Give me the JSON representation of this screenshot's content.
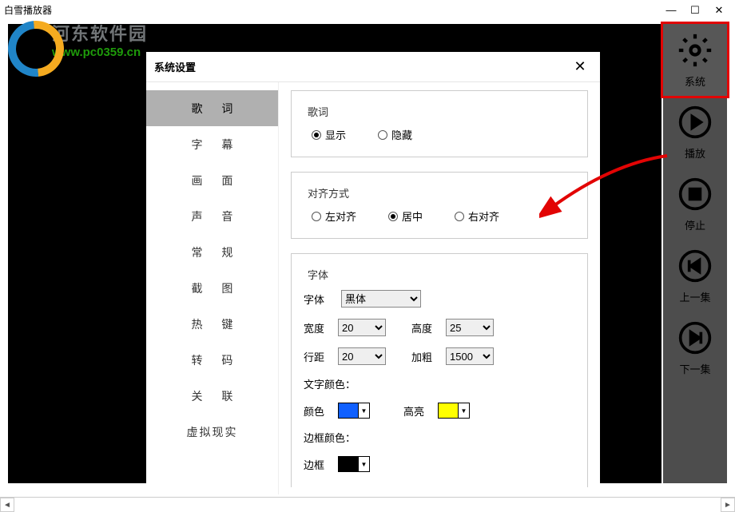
{
  "app_title": "白雪播放器",
  "watermark": {
    "text_top": "河东软件园",
    "text_bottom": "www.pc0359.cn"
  },
  "sidebar": [
    {
      "name": "system",
      "label": "系统",
      "icon": "gear",
      "highlighted": true
    },
    {
      "name": "play",
      "label": "播放",
      "icon": "play"
    },
    {
      "name": "stop",
      "label": "停止",
      "icon": "stop"
    },
    {
      "name": "prev",
      "label": "上一集",
      "icon": "prev"
    },
    {
      "name": "next",
      "label": "下一集",
      "icon": "next"
    }
  ],
  "modal": {
    "title": "系统设置",
    "tabs": [
      "歌  词",
      "字  幕",
      "画  面",
      "声  音",
      "常  规",
      "截  图",
      "热  键",
      "转  码",
      "关  联",
      "虚拟现实"
    ],
    "selected_tab": 0,
    "lyrics": {
      "section_label": "歌词",
      "show_label": "显示",
      "hide_label": "隐藏",
      "visible": "show"
    },
    "align": {
      "section_label": "对齐方式",
      "left_label": "左对齐",
      "center_label": "居中",
      "right_label": "右对齐",
      "value": "center"
    },
    "font": {
      "section_label": "字体",
      "font_label": "字体",
      "font_value": "黑体",
      "width_label": "宽度",
      "width_value": "20",
      "height_label": "高度",
      "height_value": "25",
      "spacing_label": "行距",
      "spacing_value": "20",
      "bold_label": "加粗",
      "bold_value": "1500",
      "text_color_label": "文字颜色：",
      "color_label": "颜色",
      "color_value": "#1060ff",
      "highlight_label": "高亮",
      "highlight_value": "#ffff00",
      "border_color_label": "边框颜色：",
      "border_label": "边框",
      "border_value": "#000000"
    }
  }
}
